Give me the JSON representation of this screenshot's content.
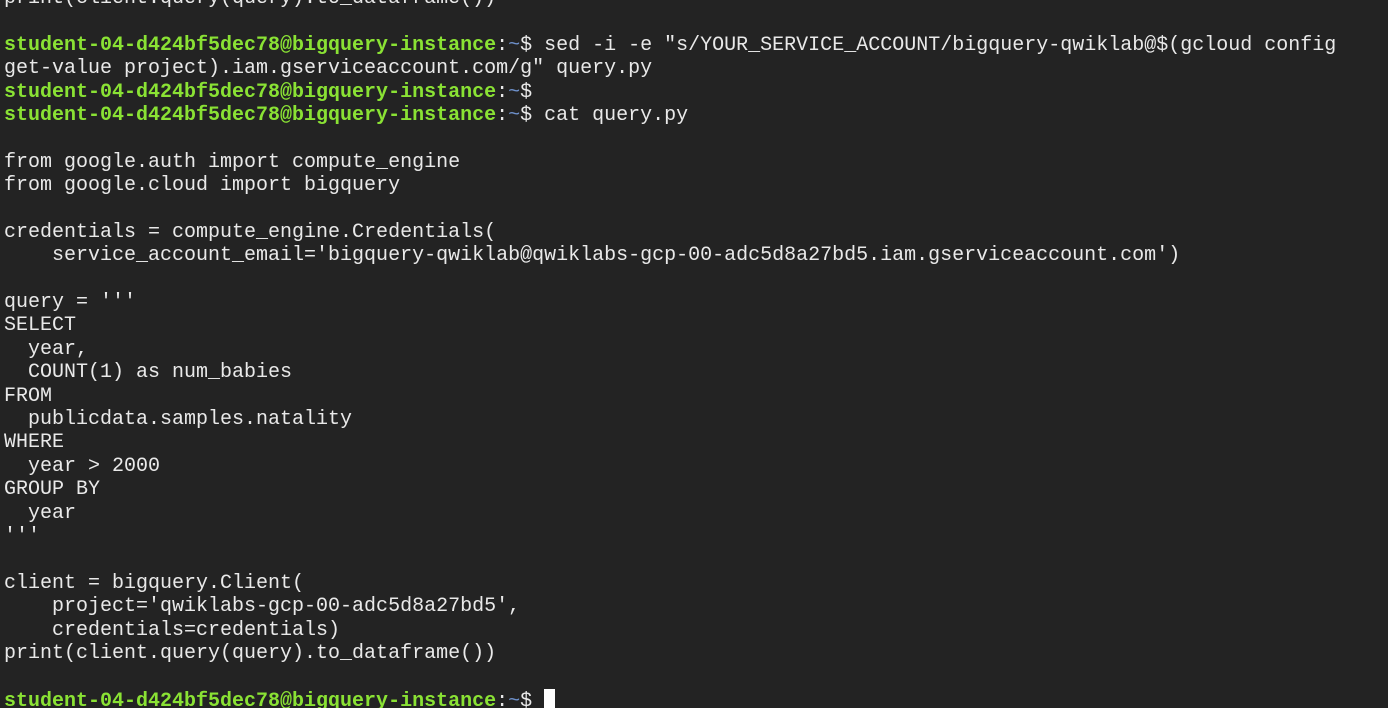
{
  "terminal": {
    "lines": [
      {
        "kind": "text",
        "text": "print(client.query(query).to_dataframe())"
      },
      {
        "kind": "text",
        "text": ""
      },
      {
        "kind": "prompt",
        "user": "student-04-d424bf5dec78@bigquery-instance",
        "path": "~",
        "symbol": "$ ",
        "command": "sed -i -e \"s/YOUR_SERVICE_ACCOUNT/bigquery-qwiklab@$(gcloud config"
      },
      {
        "kind": "text",
        "text": "get-value project).iam.gserviceaccount.com/g\" query.py"
      },
      {
        "kind": "prompt",
        "user": "student-04-d424bf5dec78@bigquery-instance",
        "path": "~",
        "symbol": "$",
        "command": ""
      },
      {
        "kind": "prompt",
        "user": "student-04-d424bf5dec78@bigquery-instance",
        "path": "~",
        "symbol": "$ ",
        "command": "cat query.py"
      },
      {
        "kind": "text",
        "text": ""
      },
      {
        "kind": "text",
        "text": "from google.auth import compute_engine"
      },
      {
        "kind": "text",
        "text": "from google.cloud import bigquery"
      },
      {
        "kind": "text",
        "text": ""
      },
      {
        "kind": "text",
        "text": "credentials = compute_engine.Credentials("
      },
      {
        "kind": "text",
        "text": "    service_account_email='bigquery-qwiklab@qwiklabs-gcp-00-adc5d8a27bd5.iam.gserviceaccount.com')"
      },
      {
        "kind": "text",
        "text": ""
      },
      {
        "kind": "text",
        "text": "query = '''"
      },
      {
        "kind": "text",
        "text": "SELECT"
      },
      {
        "kind": "text",
        "text": "  year,"
      },
      {
        "kind": "text",
        "text": "  COUNT(1) as num_babies"
      },
      {
        "kind": "text",
        "text": "FROM"
      },
      {
        "kind": "text",
        "text": "  publicdata.samples.natality"
      },
      {
        "kind": "text",
        "text": "WHERE"
      },
      {
        "kind": "text",
        "text": "  year > 2000"
      },
      {
        "kind": "text",
        "text": "GROUP BY"
      },
      {
        "kind": "text",
        "text": "  year"
      },
      {
        "kind": "text",
        "text": "'''"
      },
      {
        "kind": "text",
        "text": ""
      },
      {
        "kind": "text",
        "text": "client = bigquery.Client("
      },
      {
        "kind": "text",
        "text": "    project='qwiklabs-gcp-00-adc5d8a27bd5',"
      },
      {
        "kind": "text",
        "text": "    credentials=credentials)"
      },
      {
        "kind": "text",
        "text": "print(client.query(query).to_dataframe())"
      },
      {
        "kind": "text",
        "text": ""
      },
      {
        "kind": "prompt",
        "user": "student-04-d424bf5dec78@bigquery-instance",
        "path": "~",
        "symbol": "$ ",
        "command": "",
        "cursor": true
      }
    ]
  },
  "colors": {
    "background": "#232323",
    "foreground": "#e9e9e9",
    "prompt_user": "#8ae234",
    "prompt_path": "#6d8fc9",
    "cursor": "#ffffff"
  }
}
